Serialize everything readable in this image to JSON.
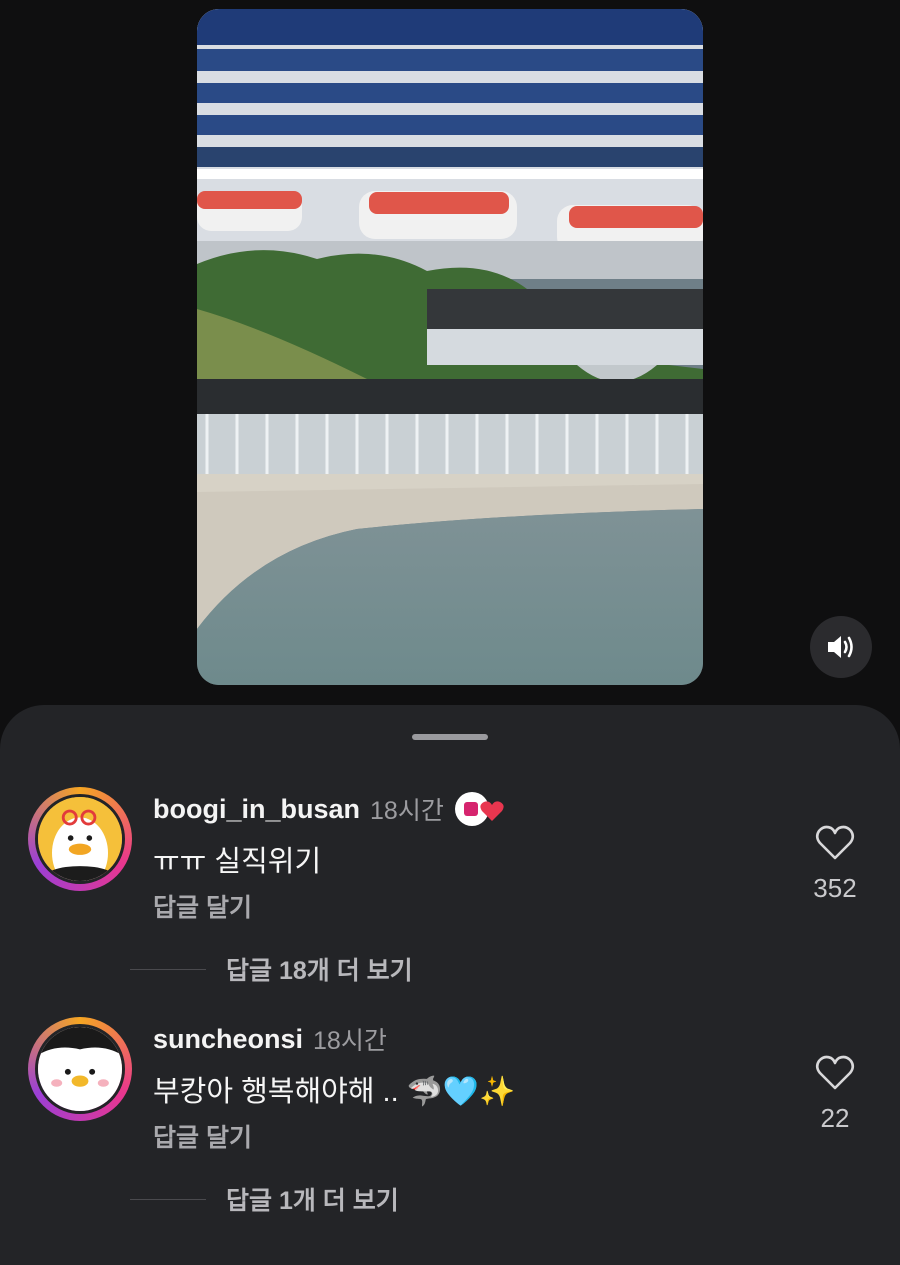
{
  "video": {
    "image_desc_name": "cruise-ship-harbor-crowd"
  },
  "sound": {
    "icon": "speaker-icon"
  },
  "comments": [
    {
      "username": "boogi_in_busan",
      "time": "18시간",
      "text": "ㅠㅠ 실직위기",
      "reply_label": "답글 달기",
      "likes": "352",
      "more_replies": "답글 18개 더 보기"
    },
    {
      "username": "suncheonsi",
      "time": "18시간",
      "text": "부캉아 행복해야해 .. 🦈🩵✨",
      "reply_label": "답글 달기",
      "likes": "22",
      "more_replies": "답글 1개 더 보기"
    }
  ],
  "colors": {
    "sheet": "#232427",
    "background": "#0f0f10",
    "badge_heart": "#e8364f"
  }
}
